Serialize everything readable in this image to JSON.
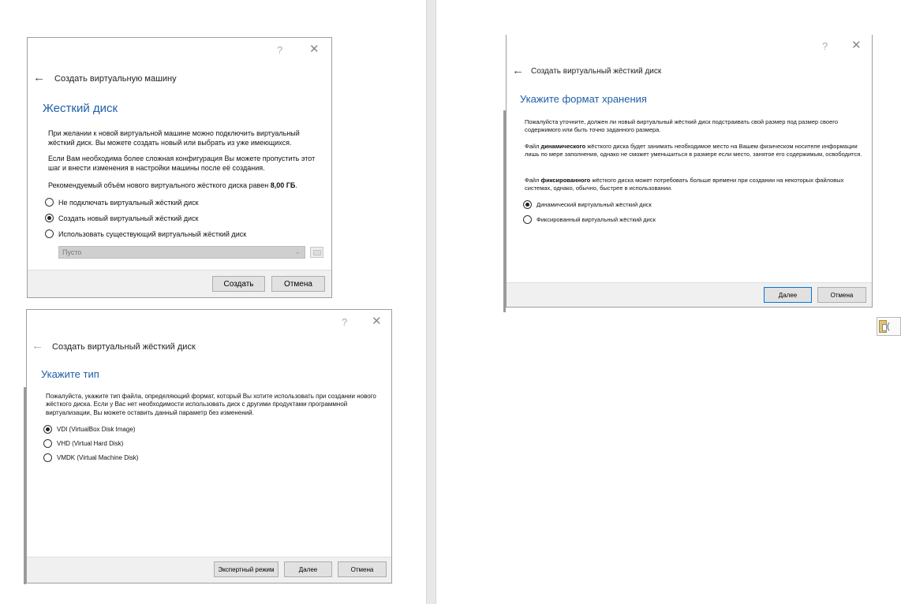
{
  "window_controls": {
    "help": "?",
    "close": "✕",
    "back": "←"
  },
  "dialog_hdd": {
    "wizard_title": "Создать виртуальную машину",
    "heading": "Жесткий диск",
    "para1": "При желании к новой виртуальной машине можно подключить виртуальный жёсткий диск. Вы можете создать новый или выбрать из уже имеющихся.",
    "para2": "Если Вам необходима более сложная конфигурация Вы можете пропустить этот шаг и внести изменения в настройки машины после её создания.",
    "para3_prefix": "Рекомендуемый объём нового виртуального жёсткого диска равен ",
    "para3_size": "8,00 ГБ",
    "para3_suffix": ".",
    "options": [
      {
        "label": "Не подключать виртуальный жёсткий диск",
        "checked": false
      },
      {
        "label": "Создать новый виртуальный жёсткий диск",
        "checked": true
      },
      {
        "label": "Использовать существующий виртуальный жёсткий диск",
        "checked": false
      }
    ],
    "combo_value": "Пусто",
    "create_button": "Создать",
    "cancel_button": "Отмена"
  },
  "dialog_type": {
    "wizard_title": "Создать виртуальный жёсткий диск",
    "heading": "Укажите тип",
    "para": "Пожалуйста, укажите тип файла, определяющий формат, который Вы хотите использовать при создании нового жёсткого диска. Если у Вас нет необходимости использовать диск с другими продуктами программной виртуализации, Вы можете оставить данный параметр без изменений.",
    "options": [
      {
        "label": "VDI (VirtualBox Disk Image)",
        "checked": true
      },
      {
        "label": "VHD (Virtual Hard Disk)",
        "checked": false
      },
      {
        "label": "VMDK (Virtual Machine Disk)",
        "checked": false
      }
    ],
    "expert_button": "Экспертный режим",
    "next_button": "Далее",
    "cancel_button": "Отмена"
  },
  "dialog_format": {
    "wizard_title": "Создать виртуальный жёсткий диск",
    "heading": "Укажите формат хранения",
    "para1": "Пожалуйста уточните, должен ли новый виртуальный жёсткий диск подстраивать свой размер под размер своего содержимого или быть точно заданного размера.",
    "para2_prefix": "Файл ",
    "para2_bold": "динамического",
    "para2_suffix": " жёсткого диска будет занимать необходимое место на Вашем физическом носителе информации лишь по мере заполнения, однако не сможет уменьшиться в размере если место, занятое его содержимым, освободится.",
    "para3_prefix": "Файл ",
    "para3_bold": "фиксированного",
    "para3_suffix": " жёсткого диска может потребовать больше времени при создании на некоторых файловых системах, однако, обычно, быстрее в использовании.",
    "options": [
      {
        "label": "Динамический виртуальный жёсткий диск",
        "checked": true
      },
      {
        "label": "Фиксированный виртуальный жёсткий диск",
        "checked": false
      }
    ],
    "next_button": "Далее",
    "cancel_button": "Отмена"
  },
  "paste_widget": {
    "label": "("
  }
}
